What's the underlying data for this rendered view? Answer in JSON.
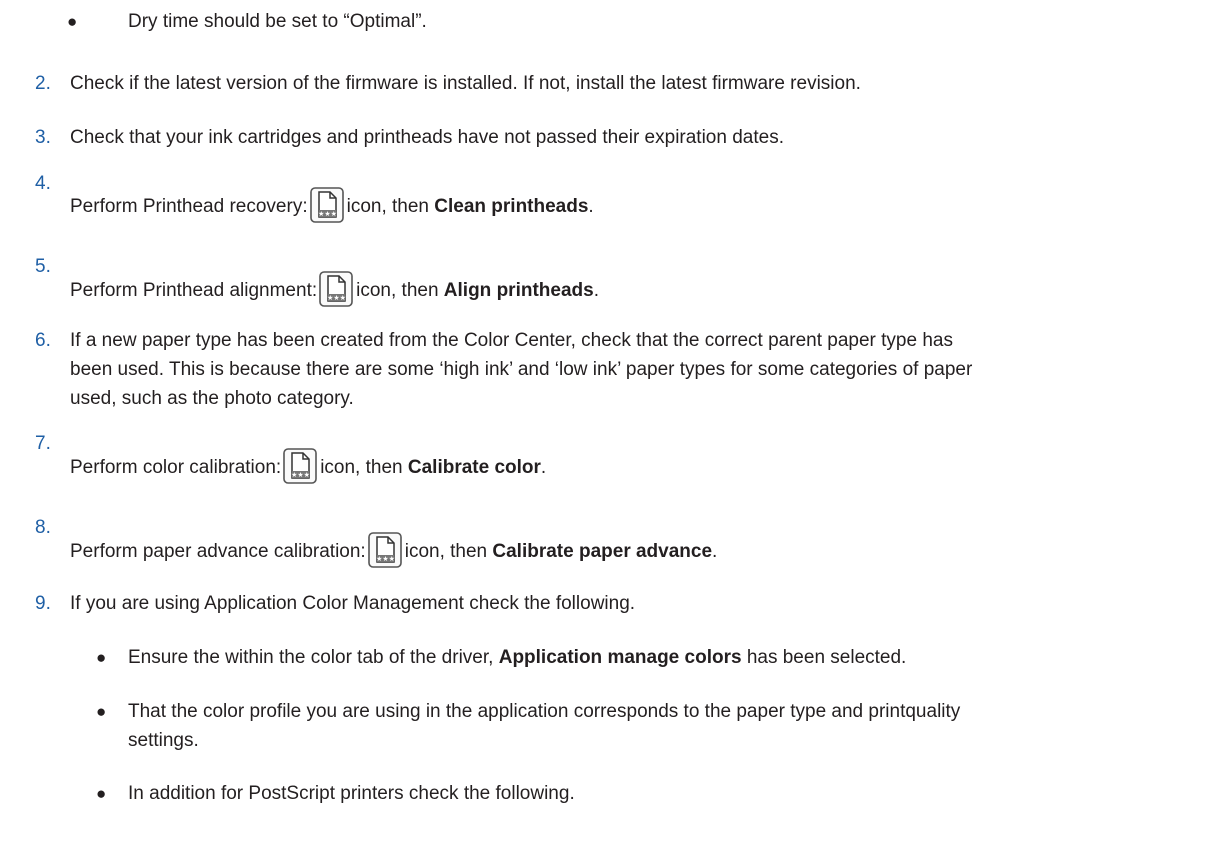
{
  "colors": {
    "number": "#1f5fa5",
    "text": "#231f20"
  },
  "icon_name": "print-settings-icon",
  "items": {
    "b0": "Dry time should be set to “Optimal”.",
    "n2": "2.",
    "t2": "Check if the latest version of the firmware is installed. If not, install the latest firmware revision.",
    "n3": "3.",
    "t3": "Check that your ink cartridges and printheads have not passed their expiration dates.",
    "n4": "4.",
    "t4a": "Perform Printhead recovery:",
    "t4b": "icon, then ",
    "t4c": "Clean printheads",
    "t4d": ".",
    "n5": "5.",
    "t5a": "Perform Printhead alignment:",
    "t5b": "icon, then ",
    "t5c": "Align printheads",
    "t5d": ".",
    "n6": "6.",
    "t6a": "If a new paper type has been created from the Color Center, check that the correct parent paper type has",
    "t6b": "been used. This is because there are some ‘high ink’ and ‘low ink’ paper types for some categories of paper",
    "t6c": "used, such as the photo category.",
    "n7": "7.",
    "t7a": "Perform color calibration:",
    "t7b": "icon, then ",
    "t7c": "Calibrate color",
    "t7d": ".",
    "n8": "8.",
    "t8a": "Perform paper advance calibration:",
    "t8b": "icon, then ",
    "t8c": "Calibrate paper advance",
    "t8d": ".",
    "n9": "9.",
    "t9": "If you are using Application Color Management check the following.",
    "b1a": "Ensure the within the color tab of the driver, ",
    "b1b": "Application manage colors",
    "b1c": " has been selected.",
    "b2a": "That the color profile you are using in the application corresponds to the paper type and printquality",
    "b2b": "settings.",
    "b3": "In addition for PostScript printers check the following.",
    "bullet": "●"
  }
}
